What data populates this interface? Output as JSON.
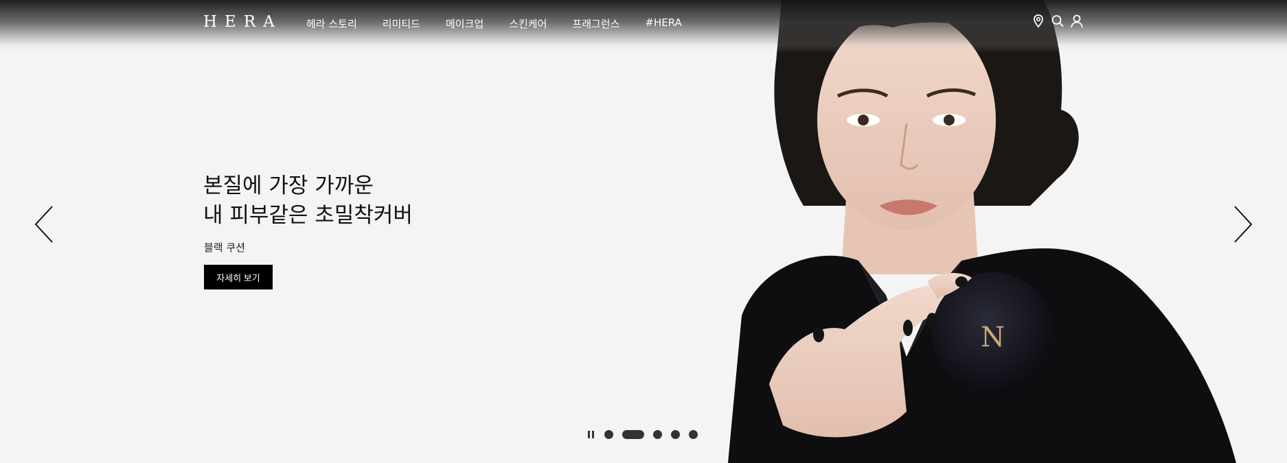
{
  "brand": {
    "logo": "HERA"
  },
  "nav": {
    "items": [
      {
        "label": "헤라 스토리"
      },
      {
        "label": "리미티드"
      },
      {
        "label": "메이크업"
      },
      {
        "label": "스킨케어"
      },
      {
        "label": "프래그런스"
      },
      {
        "label": "#HERA"
      }
    ]
  },
  "header_icons": [
    "location-pin-icon",
    "search-icon",
    "user-icon"
  ],
  "hero": {
    "headline_line1": "본질에 가장 가까운",
    "headline_line2": "내 피부같은 초밀착커버",
    "subline": "블랙 쿠션",
    "cta_label": "자세히 보기"
  },
  "slider": {
    "slide_count": 5,
    "active_index": 1,
    "playing": true
  },
  "colors": {
    "background": "#f4f4f4",
    "text": "#111111",
    "cta_bg": "#000000",
    "cta_text": "#ffffff",
    "nav_text": "#ffffff"
  }
}
